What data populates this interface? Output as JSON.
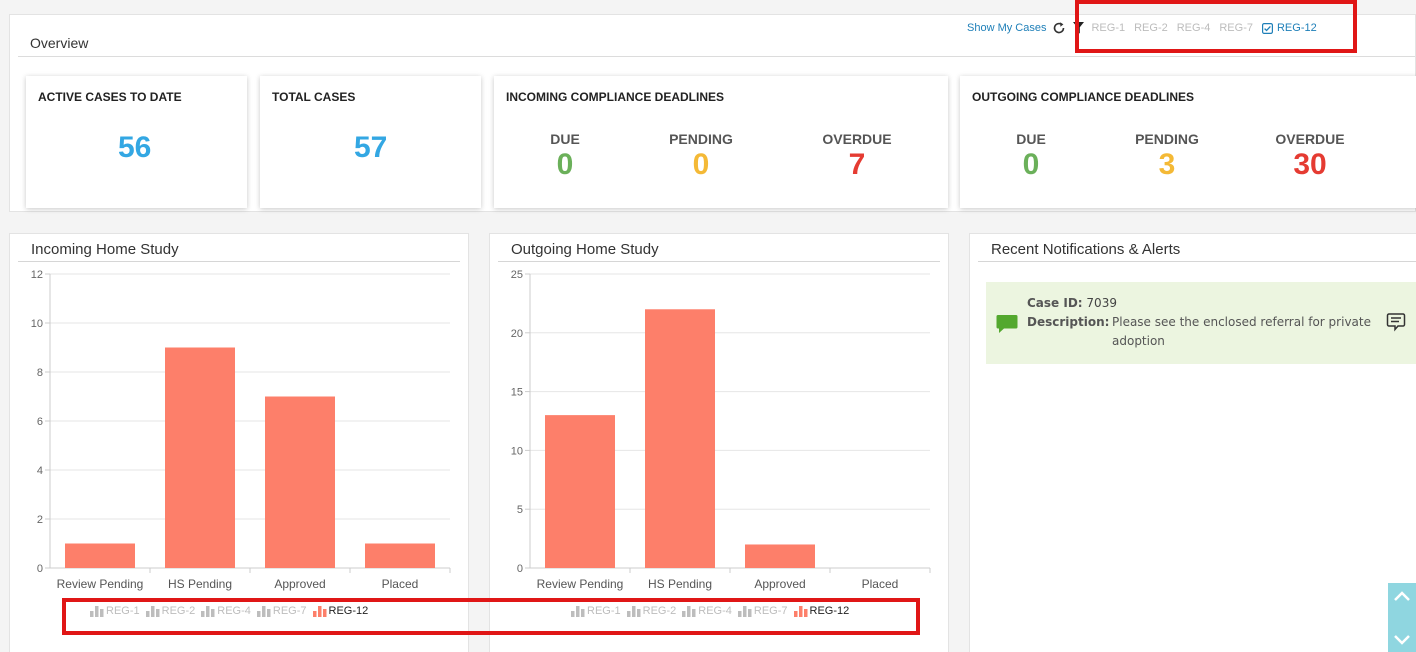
{
  "overview": {
    "title": "Overview",
    "show_my_cases": "Show My Cases",
    "filters": [
      "REG-1",
      "REG-2",
      "REG-4",
      "REG-7"
    ],
    "active_filter": "REG-12"
  },
  "cards": {
    "active_cases": {
      "label": "ACTIVE CASES TO DATE",
      "value": "56"
    },
    "total_cases": {
      "label": "TOTAL CASES",
      "value": "57"
    },
    "incoming_deadlines": {
      "label": "INCOMING COMPLIANCE DEADLINES",
      "due_label": "DUE",
      "due": "0",
      "pending_label": "PENDING",
      "pending": "0",
      "overdue_label": "OVERDUE",
      "overdue": "7"
    },
    "outgoing_deadlines": {
      "label": "OUTGOING COMPLIANCE DEADLINES",
      "due_label": "DUE",
      "due": "0",
      "pending_label": "PENDING",
      "pending": "3",
      "overdue_label": "OVERDUE",
      "overdue": "30"
    }
  },
  "colors": {
    "blue": "#33a7e3",
    "green": "#6bb05a",
    "yellow": "#f4b936",
    "red": "#e53b32",
    "bar": "#fd7f6a",
    "legend_off": "#bdbdbd",
    "accent": "#1e7fb8"
  },
  "incoming_panel": {
    "title": "Incoming Home Study"
  },
  "outgoing_panel": {
    "title": "Outgoing Home Study"
  },
  "notifications": {
    "title": "Recent Notifications & Alerts",
    "case_label": "Case ID:",
    "case_id": "7039",
    "desc_label": "Description:",
    "description": "Please see the enclosed referral for private adoption"
  },
  "chart_data": [
    {
      "type": "bar",
      "categories": [
        "Review Pending",
        "HS Pending",
        "Approved",
        "Placed"
      ],
      "series": [
        {
          "name": "REG-12",
          "values": [
            1,
            9,
            7,
            1
          ]
        }
      ],
      "legend": [
        "REG-1",
        "REG-2",
        "REG-4",
        "REG-7",
        "REG-12"
      ],
      "ylim": [
        0,
        12
      ],
      "yticks": [
        0,
        2,
        4,
        6,
        8,
        10,
        12
      ],
      "grid": true,
      "legend_position": "bottom"
    },
    {
      "type": "bar",
      "categories": [
        "Review Pending",
        "HS Pending",
        "Approved",
        "Placed"
      ],
      "series": [
        {
          "name": "REG-12",
          "values": [
            13,
            22,
            2,
            0
          ]
        }
      ],
      "legend": [
        "REG-1",
        "REG-2",
        "REG-4",
        "REG-7",
        "REG-12"
      ],
      "ylim": [
        0,
        25
      ],
      "yticks": [
        0,
        5,
        10,
        15,
        20,
        25
      ],
      "grid": true,
      "legend_position": "bottom"
    }
  ]
}
